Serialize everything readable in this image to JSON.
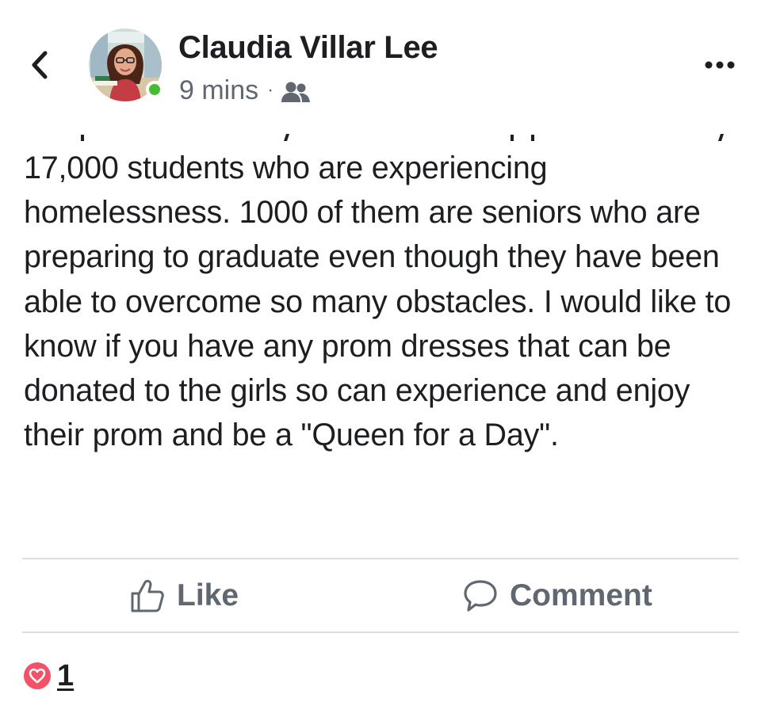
{
  "post": {
    "author_name": "Claudia Villar Lee",
    "timestamp": "9 mins",
    "separator": "·",
    "audience_icon": "friends-icon",
    "body": "17,000 students who are experiencing homelessness. 1000 of them are seniors who are preparing to graduate even though they have been able to overcome so many obstacles. I would like to know if you have any prom dresses that can be donated to the girls so can experience and enjoy their prom and be a \"Queen for a Day\".",
    "author_online": true
  },
  "header": {
    "back_icon": "chevron-left-icon",
    "more_icon": "more-horizontal-icon"
  },
  "actions": {
    "like_label": "Like",
    "like_icon": "thumbs-up-icon",
    "comment_label": "Comment",
    "comment_icon": "comment-icon"
  },
  "reactions": {
    "type_icon": "heart-icon",
    "count": "1"
  },
  "colors": {
    "text_primary": "#1c1e21",
    "text_secondary": "#606770",
    "divider": "#dadde1",
    "online": "#44bd32",
    "love": "#f25268"
  }
}
